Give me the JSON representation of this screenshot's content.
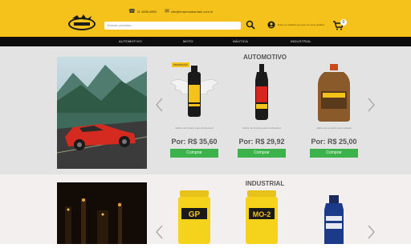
{
  "header": {
    "phone": "11 4858-8855",
    "email": "site@empresabardahl.com.br",
    "search_placeholder": "Buscar produtos...",
    "account_text": "Entre ou cadastre-se para ver seus pedidos",
    "cart_count": "0",
    "brand_color": "#f5c21b"
  },
  "nav": {
    "items": [
      "AUTOMOTIVO",
      "MOTO",
      "NÁUTICA",
      "INDUSTRIAL"
    ]
  },
  "sections": [
    {
      "title": "AUTOMOTIVO",
      "products": [
        {
          "badge": "PROMOÇÃO",
          "name": "Aditivo de limpeza para combustível",
          "price": "Por: R$ 35,60",
          "buy": "Comprar"
        },
        {
          "name": "Aditivo de limpeza para combustível",
          "price": "Por: R$ 29,92",
          "buy": "Comprar"
        },
        {
          "name": "Aditivo de proteção para radiador",
          "price": "Por: R$ 25,00",
          "buy": "Comprar"
        }
      ]
    },
    {
      "title": "INDUSTRIAL",
      "products": [
        {
          "label": "GP"
        },
        {
          "label": "MO-2"
        },
        {
          "label": ""
        }
      ]
    }
  ],
  "colors": {
    "nav": "#0d0d0d",
    "buy_button": "#3bb34a"
  }
}
